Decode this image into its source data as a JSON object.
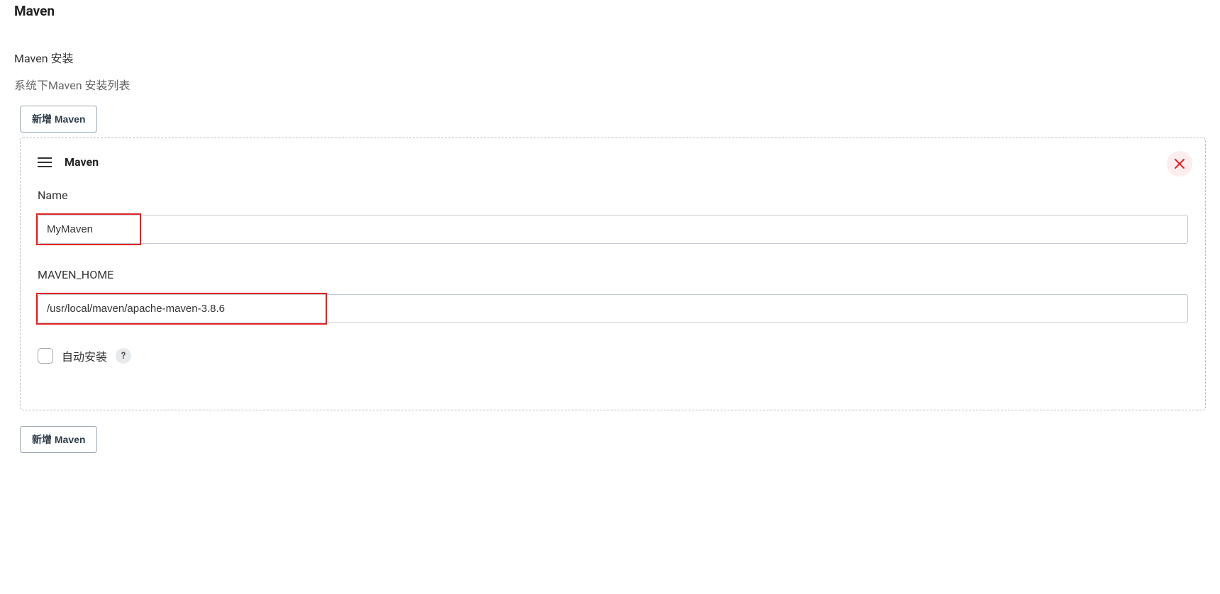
{
  "page": {
    "title": "Maven",
    "subtitle": "Maven 安装",
    "description": "系统下Maven 安装列表",
    "add_button_label": "新增 Maven"
  },
  "card": {
    "title": "Maven",
    "name": {
      "label": "Name",
      "value": "MyMaven"
    },
    "maven_home": {
      "label": "MAVEN_HOME",
      "value": "/usr/local/maven/apache-maven-3.8.6"
    },
    "auto_install": {
      "label": "自动安装",
      "help_symbol": "?"
    }
  }
}
